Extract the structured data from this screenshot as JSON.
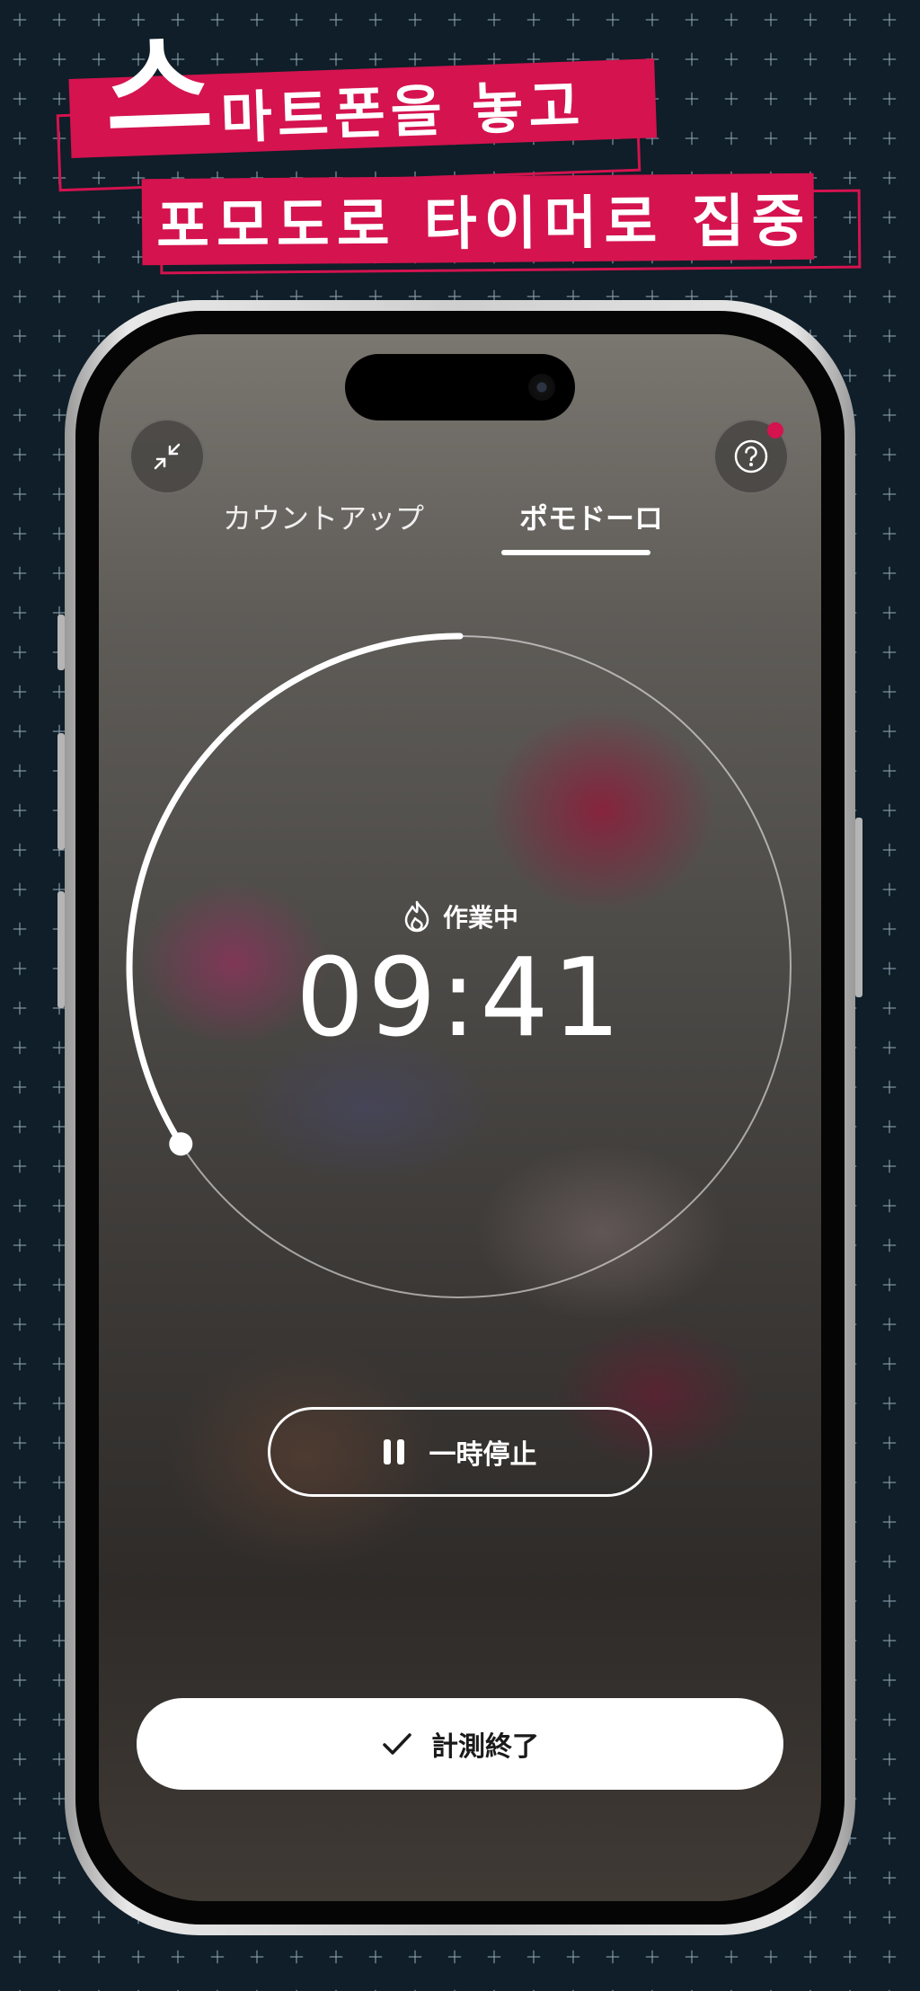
{
  "headline": {
    "line1_first": "스",
    "line1_rest": "마트폰을 놓고",
    "line2": "포모도로 타이머로 집중"
  },
  "header": {
    "collapse_icon": "collapse-arrows-icon",
    "help_icon": "question-icon"
  },
  "tabs": [
    {
      "label": "カウントアップ",
      "active": false
    },
    {
      "label": "ポモドーロ",
      "active": true
    }
  ],
  "timer": {
    "status_icon": "flame-icon",
    "status": "作業中",
    "time": "09:41",
    "progress": 0.34
  },
  "controls": {
    "pause_label": "一時停止",
    "finish_label": "計測終了"
  },
  "colors": {
    "accent": "#d4134f",
    "background": "#0f1e28"
  }
}
